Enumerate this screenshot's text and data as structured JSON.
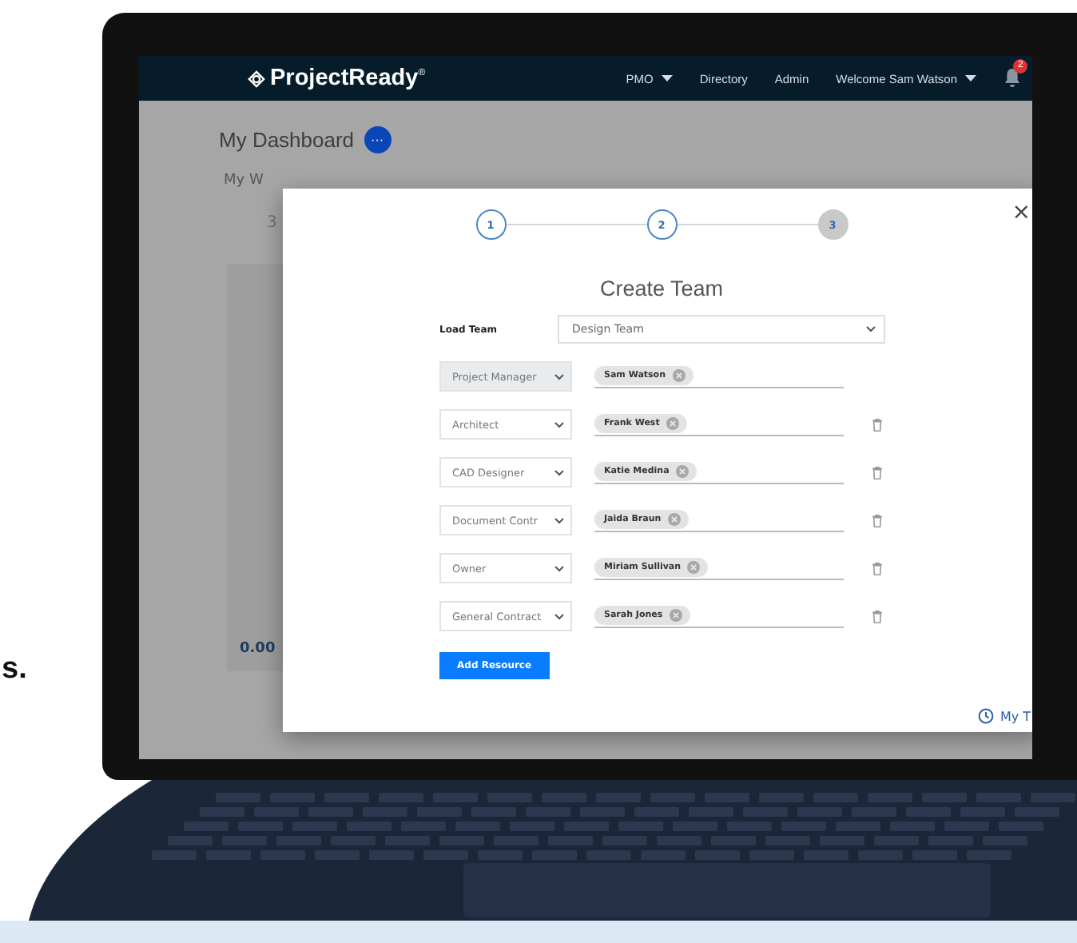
{
  "side_text": "s.",
  "nav": {
    "logo": "ProjectReady",
    "logo_mark": "®",
    "items": [
      {
        "label": "PMO",
        "dropdown": true
      },
      {
        "label": "Directory",
        "dropdown": false
      },
      {
        "label": "Admin",
        "dropdown": false
      },
      {
        "label": "Welcome Sam Watson",
        "dropdown": true
      }
    ],
    "notification_badge": "2"
  },
  "dashboard": {
    "title": "My Dashboard",
    "menu_button": "···",
    "tab": "My W",
    "number": "3",
    "chart_value": "0.00",
    "link": "My T"
  },
  "modal": {
    "steps": [
      {
        "label": "1",
        "selected": false
      },
      {
        "label": "2",
        "selected": false
      },
      {
        "label": "3",
        "selected": true
      }
    ],
    "close": "×",
    "title": "Create Team",
    "load_team": {
      "label": "Load Team",
      "value": "Design Team"
    },
    "members": [
      {
        "role": "Project Manager",
        "person": "Sam Watson",
        "disabled": true
      },
      {
        "role": "Architect",
        "person": "Frank West",
        "disabled": false
      },
      {
        "role": "CAD Designer",
        "person": "Katie Medina",
        "disabled": false
      },
      {
        "role": "Document Contr",
        "person": "Jaida Braun",
        "disabled": false
      },
      {
        "role": "Owner",
        "person": "Miriam Sullivan",
        "disabled": false
      },
      {
        "role": "General Contract",
        "person": "Sarah Jones",
        "disabled": false
      }
    ],
    "add_button": "Add Resource"
  }
}
